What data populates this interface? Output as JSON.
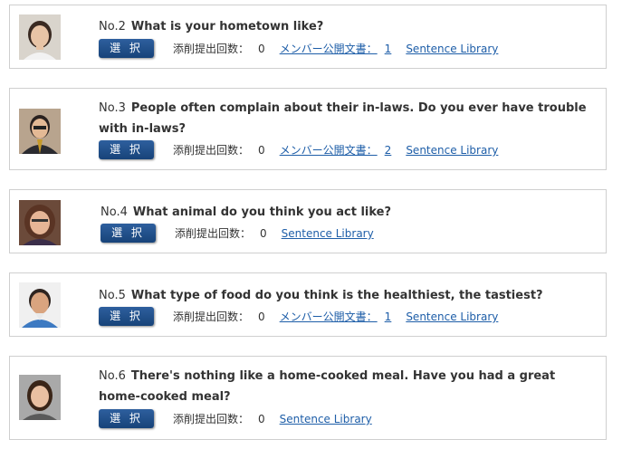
{
  "colors": {
    "button": "#1f4f8a",
    "link": "#1e5ea8",
    "border": "#cfcfcf"
  },
  "select_label": "選 択",
  "submission_label": "添削提出回数：",
  "public_label": "メンバー公開文書：",
  "library_label": "Sentence Library",
  "items": [
    {
      "no": "No.2",
      "question": "What is your hometown like?",
      "submission_count": "0",
      "public_count": "1"
    },
    {
      "no": "No.3",
      "question": "People often complain about their in-laws. Do you ever have trouble with in-laws?",
      "submission_count": "0",
      "public_count": "2"
    },
    {
      "no": "No.4",
      "question": "What animal do you think you act like?",
      "submission_count": "0"
    },
    {
      "no": "No.5",
      "question": "What type of food do you think is the healthiest, the tastiest?",
      "submission_count": "0",
      "public_count": "1"
    },
    {
      "no": "No.6",
      "question": "There's nothing like a home-cooked meal. Have you had a great home-cooked meal?",
      "submission_count": "0"
    }
  ]
}
